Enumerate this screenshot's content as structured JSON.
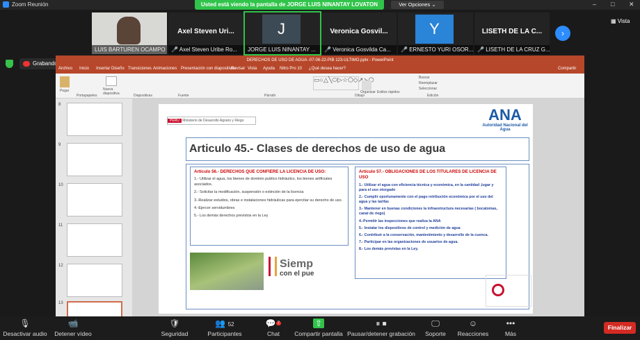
{
  "window": {
    "title": "Zoom Reunión",
    "gallery_view": "Vista"
  },
  "banner": {
    "text": "Usted está viendo la pantalla de JORGE LUIS NINANTAY LOVATON",
    "options": "Ver Opciones"
  },
  "participants": [
    {
      "display": "",
      "label": "LUIS BARTUREN OCAMPO",
      "type": "video"
    },
    {
      "display": "Axel Steven Uri...",
      "label": "Axel Steven Uribe Ro...",
      "type": "name"
    },
    {
      "display": "J",
      "label": "JORGE LUIS NINANTAY ...",
      "type": "avatar",
      "color": "#3c4a55"
    },
    {
      "display": "Veronica Gosvil...",
      "label": "Veronica Gosvilda Ca...",
      "type": "name"
    },
    {
      "display": "Y",
      "label": "ERNESTO YURI OSOR...",
      "type": "avatar",
      "color": "#2a84d8"
    },
    {
      "display": "LISETH DE LA C...",
      "label": "LISETH DE LA CRUZ G...",
      "type": "name"
    }
  ],
  "recording": "Grabando...",
  "ppt": {
    "title": "DERECHOS DE USO DE AGUA -07-06-22-PIB 123-ULTIMO.pptx - PowerPoint",
    "tabs": [
      "Archivo",
      "Inicio",
      "Insertar",
      "Diseño",
      "Transiciones",
      "Animaciones",
      "Presentación con diapositivas",
      "Revisar",
      "Vista",
      "Ayuda",
      "Nitro Pro 10",
      "¿Qué desea hacer?"
    ],
    "share": "Compartir",
    "ribbon": {
      "paste": "Pegar",
      "clipboard": "Portapapeles",
      "new_slide": "Nueva diapositiva",
      "slides": "Diapositivas",
      "font": "Fuente",
      "paragraph": "Párrafo",
      "drawing": "Dibujo",
      "editing": "Edición",
      "find": "Buscar",
      "replace": "Reemplazar",
      "select": "Seleccionar",
      "arrange": "Organizar",
      "styles": "Estilos rápidos"
    },
    "slide_numbers": [
      "8",
      "9",
      "10",
      "11",
      "12",
      "13"
    ]
  },
  "slide": {
    "ministry": "Ministerio de Desarrollo Agrario y Riego",
    "peru": "PERÚ",
    "ana_logo": "ANA",
    "ana_sub": "Autoridad Nacional del Agua",
    "title": "Articulo 45.- Clases de derechos de uso de agua",
    "box1_head": "Artículo 56.- DERECHOS QUE CONFIERE LA LICENCIA DE USO:",
    "box1_items": [
      "1.- Utilizar el agua, los bienes de dominio publico hidráulico, los bienes artificiales asociados.",
      "2.- Solicitar la modificación, suspensión o extinción de la licencia",
      "3.-Realizar estudios, obras e instalaciones hidráulicas para ejercitar su derecho de uso.",
      "4.-Ejercer servidumbres",
      "5.- Los demás derechos previstos en la Ley"
    ],
    "box2_head": "Artículo 57.- OBLIGACIONES DE LOS TITULARES DE LICENCIA DE USO",
    "box2_items": [
      "1.- Utilizar el agua con eficiencia técnica y económica, en la cantidad ,lugar y para el uso otorgado",
      "2.- Cumplir oportunamente con el pago retribución económica por el uso del agua y las tarifas",
      "3.- Mantener en buenas condiciones la infraestructura necesarias ( bocatomas, canal de riego)",
      "4.-Permitir las inspecciones que realiza la ANA",
      "5.- Instalar los dispositivos de control y medición de agua",
      "6.- Contribuir a la conservación, mantenimiento y desarrollo de la cuenca.",
      "7.- Participar en las organizaciones de usuarios de agua.",
      "8.- Los demás previstas en la Ley."
    ],
    "siempre_line1": "Siemp",
    "siempre_line2": "con el pue"
  },
  "controls": {
    "audio": "Desactivar audio",
    "video": "Detener vídeo",
    "security": "Seguridad",
    "participants": "Participantes",
    "participants_count": "52",
    "chat": "Chat",
    "chat_badge": "7",
    "share": "Compartir pantalla",
    "pause": "Pausar/detener grabación",
    "support": "Soporte",
    "reactions": "Reacciones",
    "more": "Más",
    "end": "Finalizar"
  }
}
